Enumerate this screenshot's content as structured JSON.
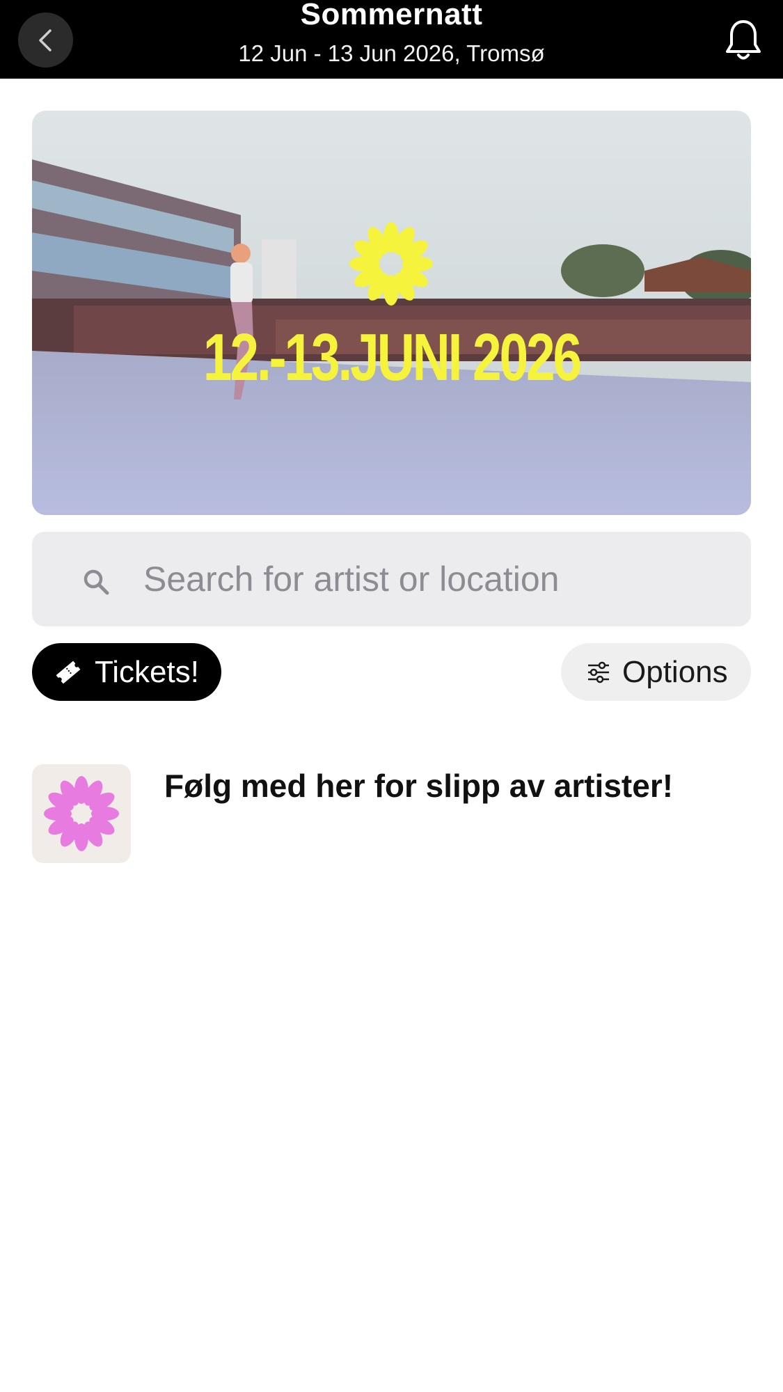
{
  "header": {
    "title": "Sommernatt",
    "subtitle": "12 Jun - 13 Jun 2026, Tromsø",
    "back_icon": "chevron-left-icon",
    "notification_icon": "bell-icon"
  },
  "hero": {
    "date_text": "12.-13.JUNI 2026",
    "logo_color": "#f6f33c"
  },
  "search": {
    "placeholder": "Search for artist or location",
    "value": ""
  },
  "actions": {
    "tickets_label": "Tickets!",
    "tickets_icon": "ticket-icon",
    "options_label": "Options",
    "options_icon": "sliders-icon"
  },
  "feed": {
    "items": [
      {
        "title": "Følg med her for slipp av artister!",
        "logo_color": "#e87be0"
      }
    ]
  }
}
